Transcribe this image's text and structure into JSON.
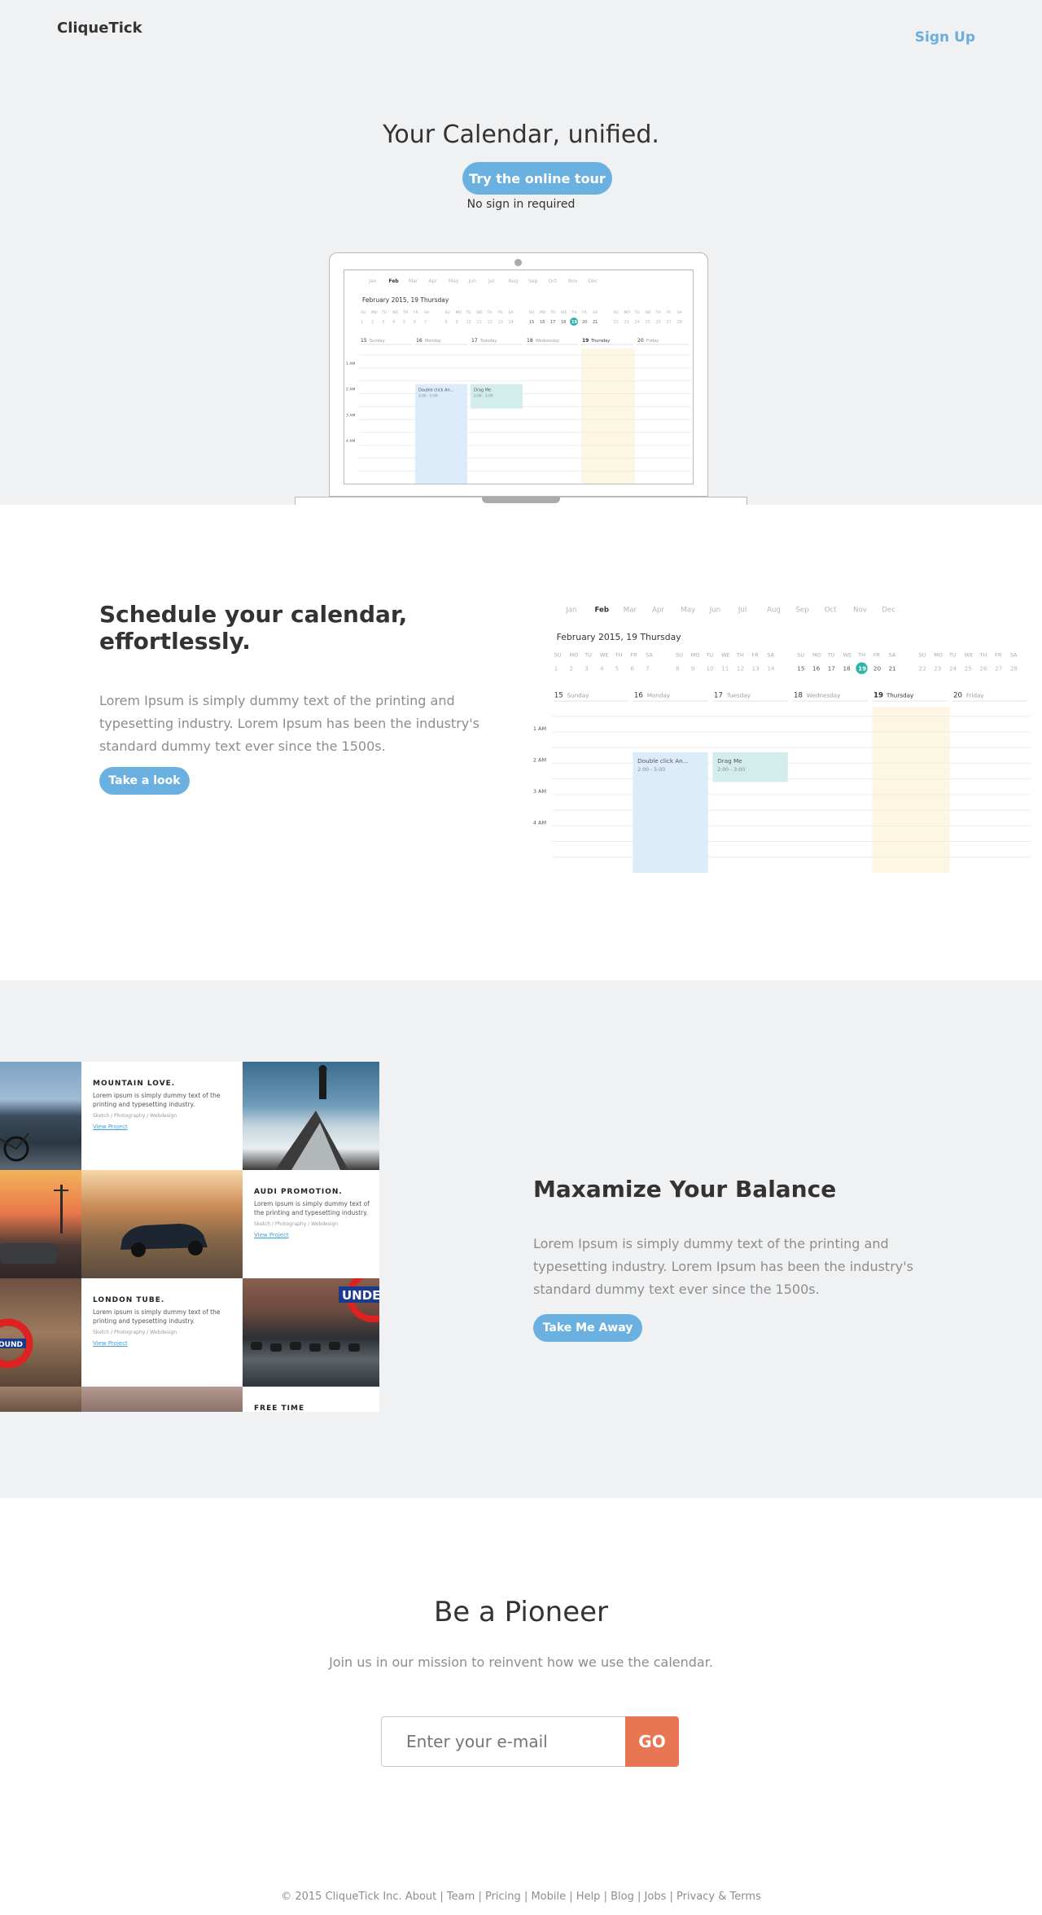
{
  "brand": "CliqueTick",
  "nav": {
    "signup": "Sign Up"
  },
  "hero": {
    "title": "Your Calendar, unified.",
    "cta": "Try the online tour",
    "note": "No sign in required"
  },
  "calendar": {
    "months": [
      "Jan",
      "Feb",
      "Mar",
      "Apr",
      "May",
      "Jun",
      "Jul",
      "Aug",
      "Sep",
      "Oct",
      "Nov",
      "Dec"
    ],
    "active_month": "Feb",
    "date_heading": "February 2015, 19 Thursday",
    "weekday_abbr": [
      "SU",
      "MO",
      "TU",
      "WE",
      "TH",
      "FR",
      "SA"
    ],
    "week_numbers": [
      [
        "1",
        "2",
        "3",
        "4",
        "5",
        "6",
        "7"
      ],
      [
        "8",
        "9",
        "10",
        "11",
        "12",
        "13",
        "14"
      ],
      [
        "15",
        "16",
        "17",
        "18",
        "19",
        "20",
        "21"
      ],
      [
        "22",
        "23",
        "24",
        "25",
        "26",
        "27",
        "28"
      ]
    ],
    "today": "19",
    "day_columns": [
      {
        "num": "15",
        "name": "Sunday"
      },
      {
        "num": "16",
        "name": "Monday"
      },
      {
        "num": "17",
        "name": "Tuesday"
      },
      {
        "num": "18",
        "name": "Wednesday"
      },
      {
        "num": "19",
        "name": "Thursday"
      },
      {
        "num": "20",
        "name": "Friday"
      }
    ],
    "hours": [
      "1 AM",
      "2 AM",
      "3 AM",
      "4 AM"
    ],
    "events": [
      {
        "title": "Double click An...",
        "time": "2:00 - 5:00",
        "color": "#dcecfb"
      },
      {
        "title": "Drag Me",
        "time": "2:00 - 3:00",
        "color": "#d3ecec"
      }
    ],
    "today_color": "#fcf6e2",
    "today_badge_color": "#30b3a8"
  },
  "feature1": {
    "title": "Schedule your calendar, effortlessly.",
    "text": "Lorem Ipsum is simply dummy text of the printing and typesetting industry. Lorem Ipsum has been the industry's standard dummy text ever since the 1500s.",
    "cta": "Take a look"
  },
  "gallery": {
    "cards": [
      {
        "title": "MOUNTAIN LOVE.",
        "text": "Lorem ipsum is simply dummy text of the printing and typesetting industry.",
        "meta": "Sketch / Photography / Webdesign",
        "link": "View Project"
      },
      {
        "title": "AUDI PROMOTION.",
        "text": "Lorem ipsum is simply dummy text of the printing and typesetting industry.",
        "meta": "Sketch / Photography / Webdesign",
        "link": "View Project"
      },
      {
        "title": "LONDON TUBE.",
        "text": "Lorem ipsum is simply dummy text of the printing and typesetting industry.",
        "meta": "Sketch / Photography / Webdesign",
        "link": "View Project"
      },
      {
        "title": "FREE TIME",
        "text": "",
        "meta": "",
        "link": ""
      }
    ],
    "sign_text": "UNDE",
    "roundel_text": "OUND"
  },
  "feature2": {
    "title": "Maxamize Your Balance",
    "text": "Lorem Ipsum is simply dummy text of the printing and typesetting industry. Lorem Ipsum has been the industry's standard dummy text ever since the 1500s.",
    "cta": "Take Me Away"
  },
  "signup_section": {
    "title": "Be a Pioneer",
    "text": "Join us in our mission to reinvent how we use the calendar.",
    "placeholder": "Enter your e-mail",
    "go": "GO"
  },
  "footer": {
    "copyright": "© 2015 CliqueTick Inc.",
    "links": [
      "About",
      "Team",
      "Pricing",
      "Mobile",
      "Help",
      "Blog",
      "Jobs",
      "Privacy & Terms"
    ]
  }
}
